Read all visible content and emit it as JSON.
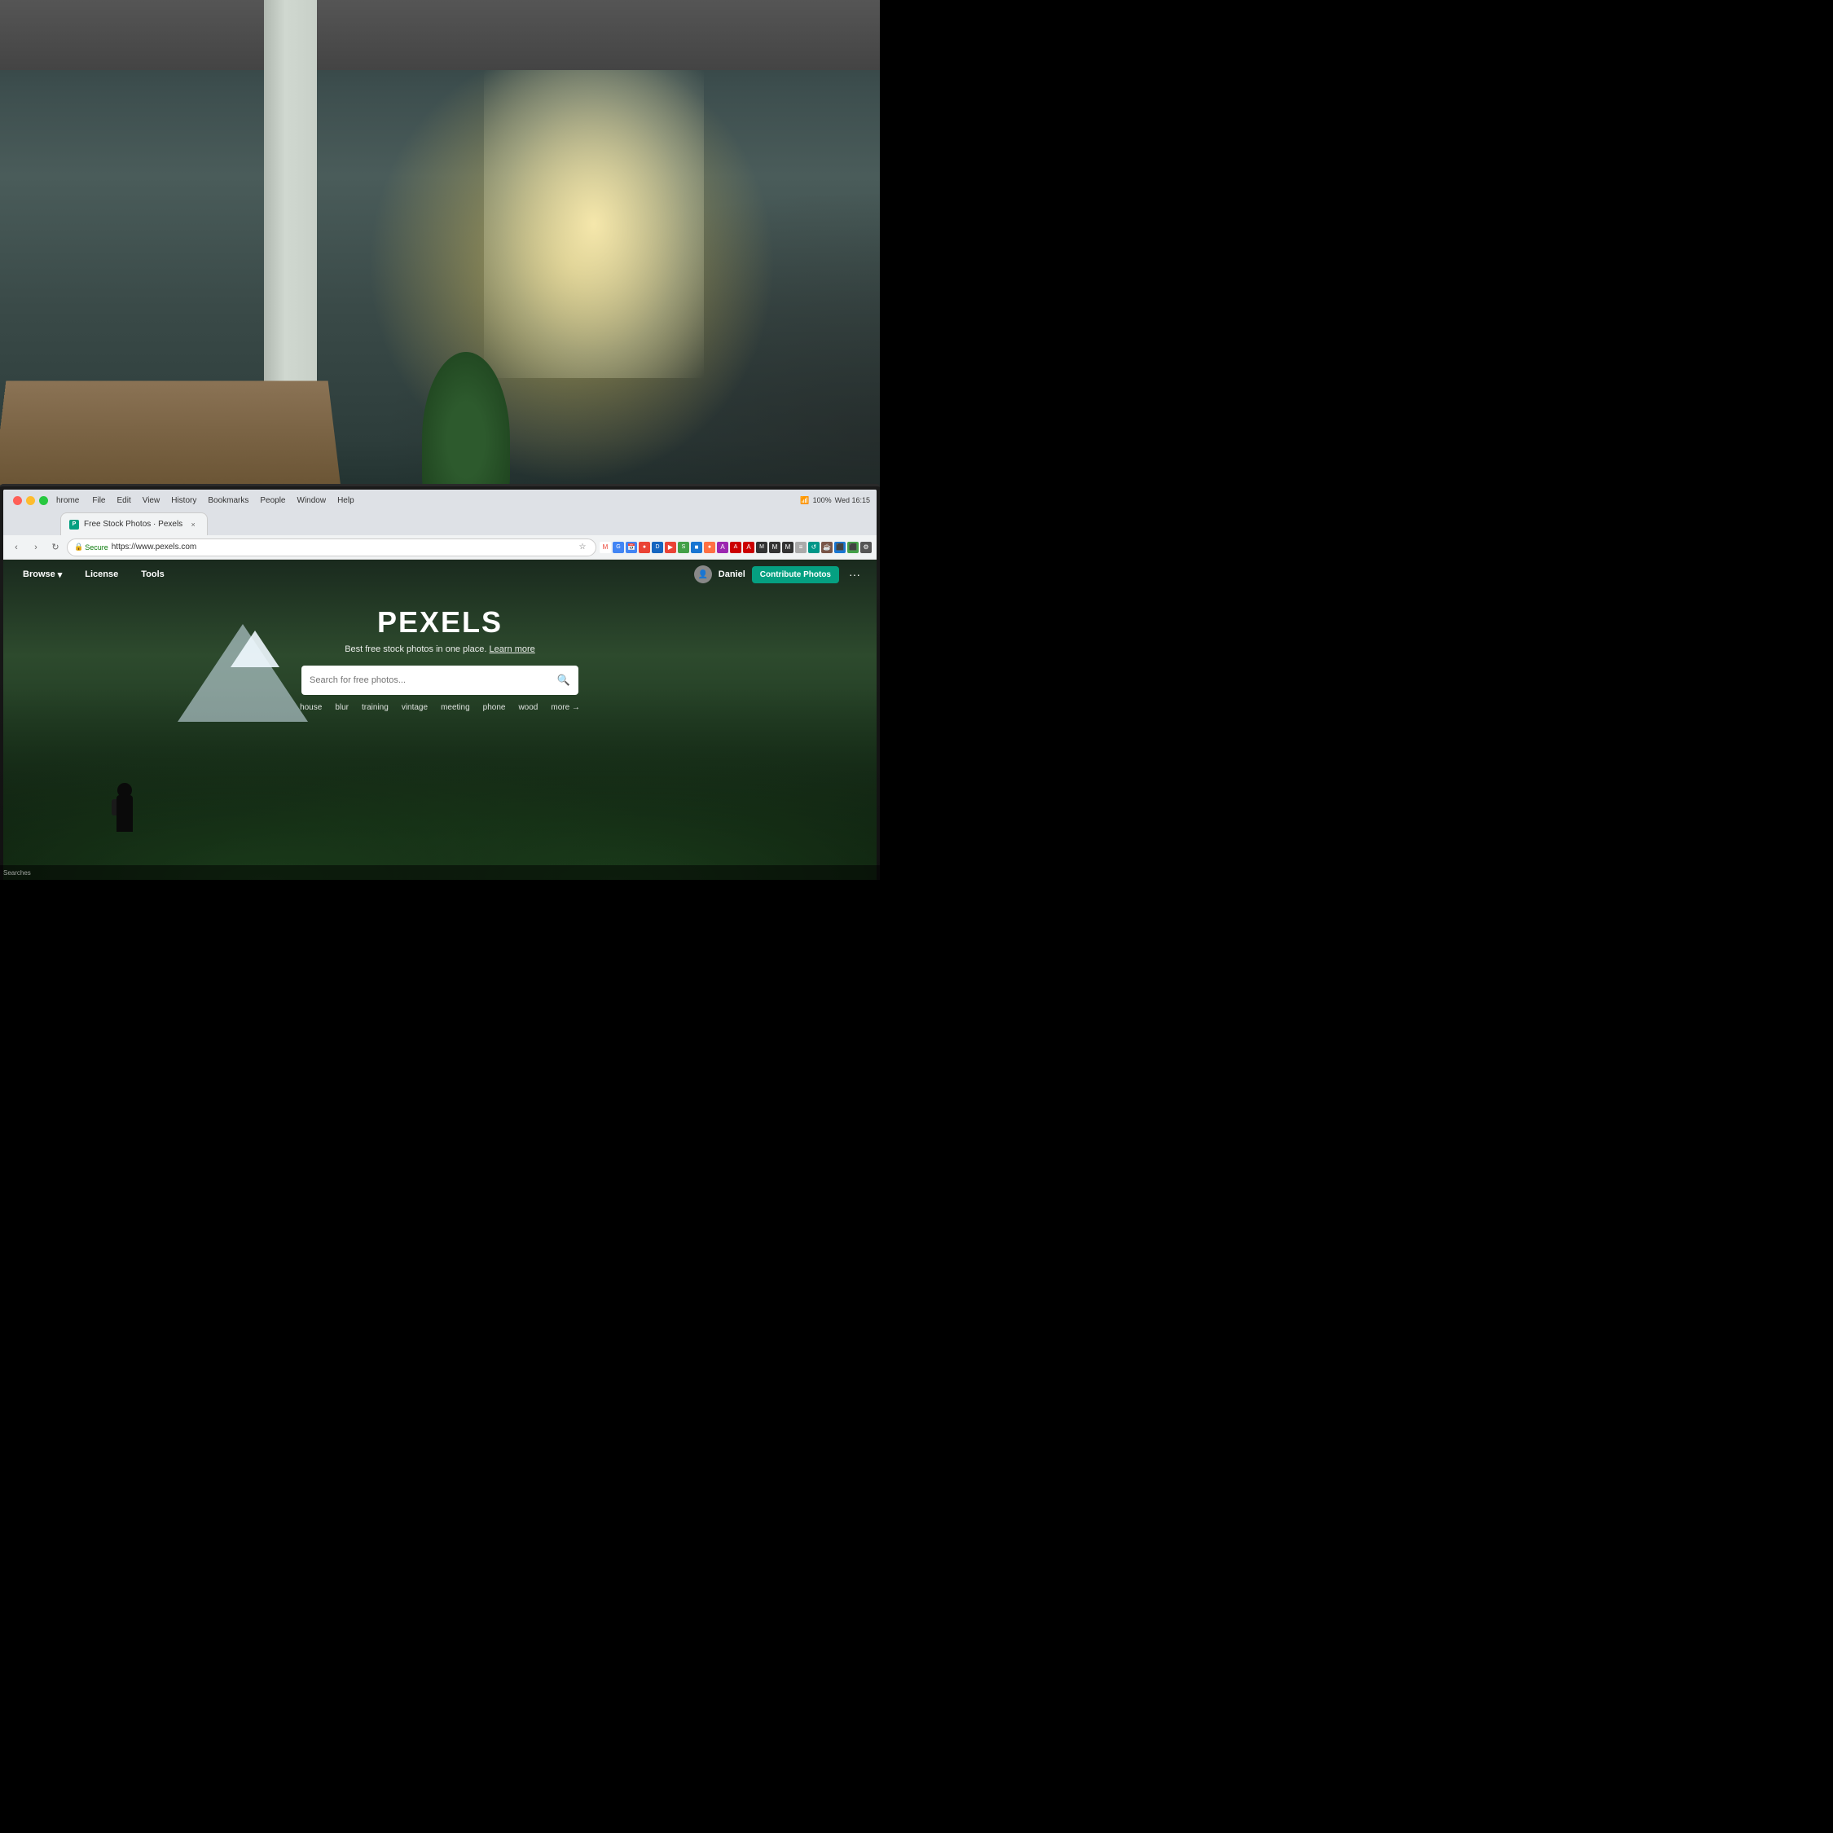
{
  "background": {
    "description": "Office workspace background with window light, plants, and desk"
  },
  "monitor": {
    "bezel_color": "#1a1a1a"
  },
  "browser": {
    "name": "Chrome",
    "menu_items": [
      "File",
      "Edit",
      "View",
      "History",
      "Bookmarks",
      "People",
      "Window",
      "Help"
    ],
    "app_name": "hrome",
    "time": "Wed 16:15",
    "battery": "100%",
    "tab": {
      "favicon_letter": "P",
      "title": "Free Stock Photos · Pexels",
      "close_label": "×"
    },
    "address_bar": {
      "secure_label": "Secure",
      "url": "https://www.pexels.com"
    },
    "back_btn": "‹",
    "forward_btn": "›",
    "reload_btn": "↻"
  },
  "pexels": {
    "nav": {
      "browse_label": "Browse",
      "license_label": "License",
      "tools_label": "Tools",
      "user_name": "Daniel",
      "contribute_label": "Contribute Photos",
      "more_label": "···"
    },
    "hero": {
      "logo": "PEXELS",
      "tagline": "Best free stock photos in one place.",
      "learn_more": "Learn more",
      "search_placeholder": "Search for free photos...",
      "search_icon": "🔍",
      "suggestions": [
        "house",
        "blur",
        "training",
        "vintage",
        "meeting",
        "phone",
        "wood",
        "more →"
      ]
    }
  },
  "taskbar": {
    "label": "Searches"
  },
  "icons": {
    "search": "🔍",
    "chevron_down": "▾",
    "lock": "🔒",
    "star": "★",
    "shield": "🛡"
  }
}
